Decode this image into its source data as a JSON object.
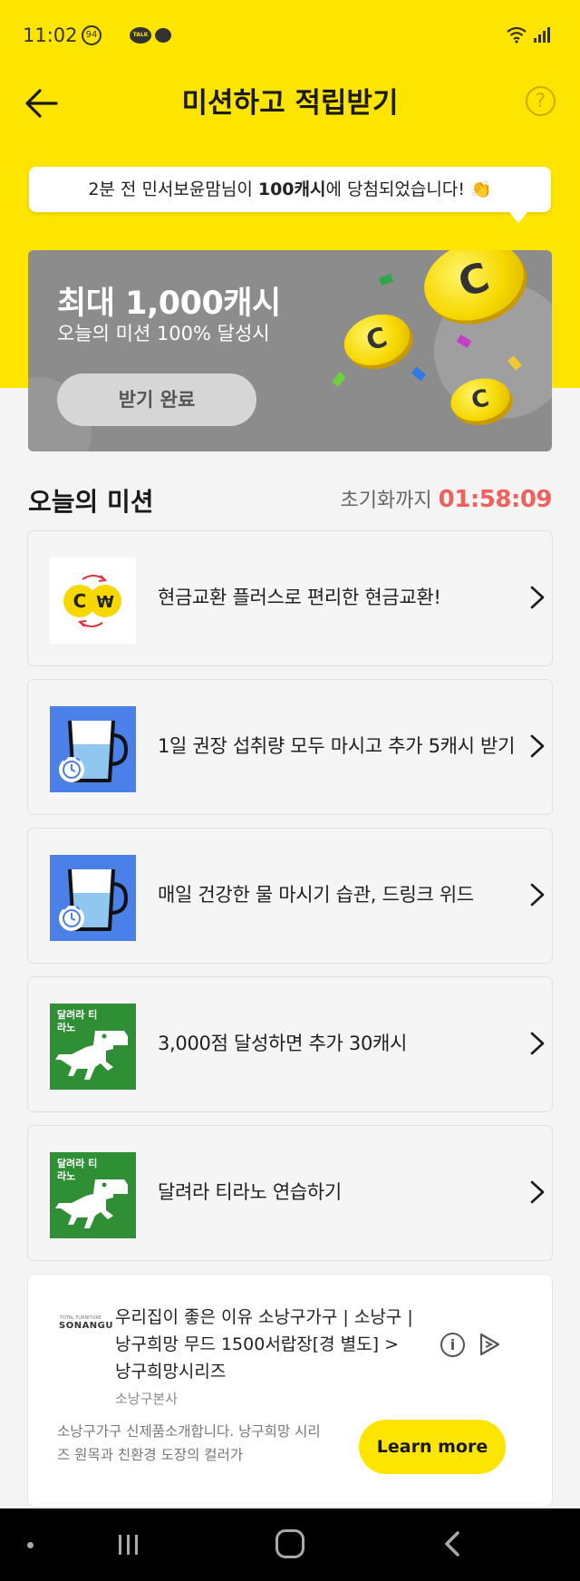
{
  "status_bar": {
    "time": "11:02",
    "badge_count": "94",
    "talk_label": "TALK"
  },
  "header": {
    "title": "미션하고 적립받기",
    "help_label": "?"
  },
  "winner_bubble": {
    "prefix": "2분 전 민서보윤맘님이 ",
    "amount": "100캐시",
    "suffix": "에 당첨되었습니다! 👏"
  },
  "banner": {
    "title": "최대 1,000캐시",
    "subtitle": "오늘의 미션 100% 달성시",
    "button_label": "받기 완료",
    "coin_letter": "C"
  },
  "missions_section": {
    "title": "오늘의 미션",
    "reset_label": "초기화까지 ",
    "reset_time": "01:58:09"
  },
  "missions": [
    {
      "label": "현금교환 플러스로 편리한 현금교환!",
      "icon": "cash-exchange-icon",
      "thumb_text": ""
    },
    {
      "label": "1일 권장 섭취량 모두 마시고 추가 5캐시 받기",
      "icon": "water-cup-alarm-icon",
      "thumb_text": ""
    },
    {
      "label": "매일 건강한 물 마시기 습관, 드링크 위드",
      "icon": "water-cup-alarm-icon",
      "thumb_text": ""
    },
    {
      "label": "3,000점 달성하면 추가 30캐시",
      "icon": "dinosaur-game-icon",
      "thumb_text": "달려라 티라노"
    },
    {
      "label": "달려라 티라노 연습하기",
      "icon": "dinosaur-game-icon",
      "thumb_text": "달려라 티라노"
    }
  ],
  "ad": {
    "logo_top": "TOTAL FURNITURE",
    "logo_text": "SONANGU",
    "headline": "우리집이 좋은 이유 소낭구가구 | 소낭구 | 낭구희망 무드 1500서랍장[경 별도] > 낭구희망시리즈",
    "brand": "소낭구본사",
    "body": "소낭구가구 신제품소개합니다. 낭구희망 시리즈 원목과 친환경 도장의 컬러가",
    "cta": "Learn more",
    "info_label": "i"
  },
  "colors": {
    "brand_yellow": "#fde500",
    "timer_red": "#f0605c",
    "banner_gray": "#8c8c8c",
    "thumb_blue": "#4a80e8",
    "thumb_green": "#2f8f34"
  }
}
